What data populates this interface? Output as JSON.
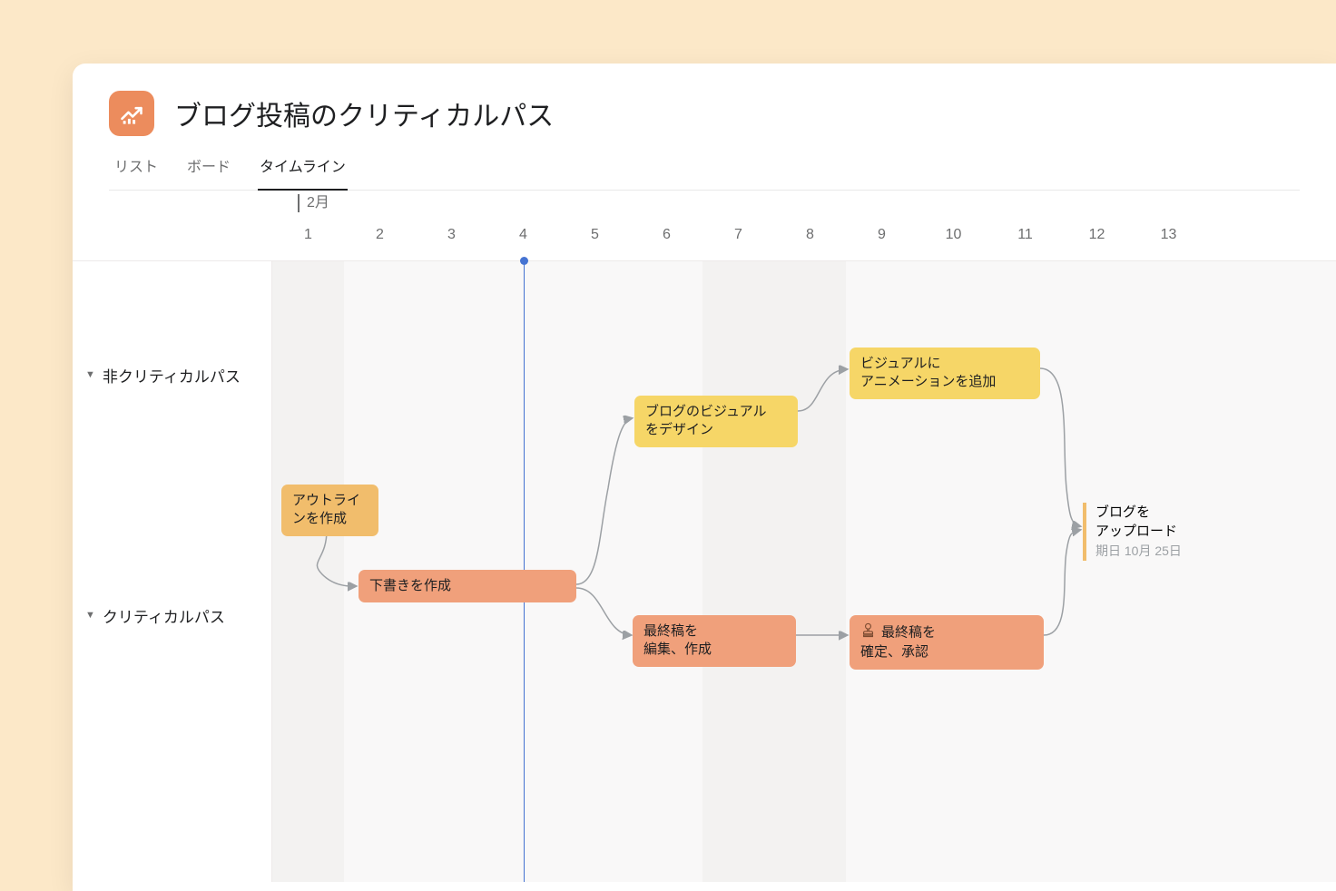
{
  "project": {
    "title": "ブログ投稿のクリティカルパス"
  },
  "tabs": {
    "list": "リスト",
    "board": "ボード",
    "timeline": "タイムライン"
  },
  "month_label": "2月",
  "days": [
    "1",
    "2",
    "3",
    "4",
    "5",
    "6",
    "7",
    "8",
    "9",
    "10",
    "11",
    "12",
    "13"
  ],
  "sections": {
    "noncritical": "非クリティカルパス",
    "critical": "クリティカルパス"
  },
  "tasks": {
    "design_visual": {
      "line1": "ブログのビジュアル",
      "line2": "をデザイン"
    },
    "animate_visual": {
      "line1": "ビジュアルに",
      "line2": "アニメーションを追加"
    },
    "outline": {
      "line1": "アウトライ",
      "line2": "ンを作成"
    },
    "draft": "下書きを作成",
    "edit_final": {
      "line1": "最終稿を",
      "line2": "編集、作成"
    },
    "approve_final": {
      "line1": "最終稿を",
      "line2": "確定、承認"
    },
    "upload": {
      "line1": "ブログを",
      "line2": "アップロード",
      "due": "期日 10月 25日"
    }
  }
}
